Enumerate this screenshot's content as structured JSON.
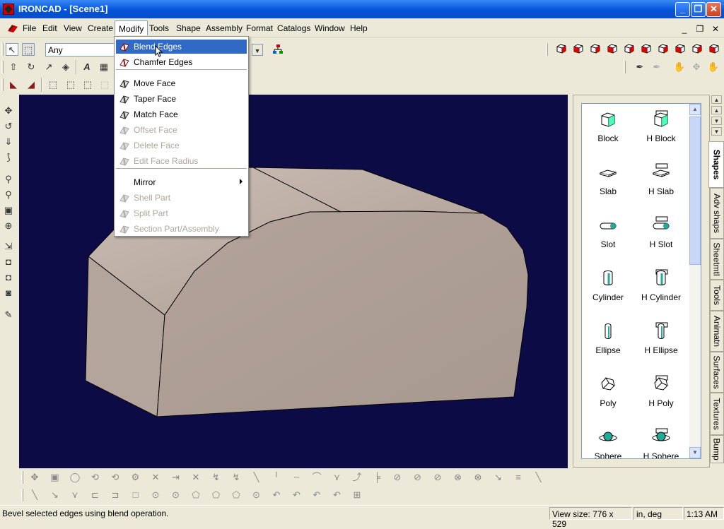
{
  "window": {
    "title": "IRONCAD - [Scene1]"
  },
  "menubar": {
    "items": [
      "File",
      "Edit",
      "View",
      "Create",
      "Modify",
      "Tools",
      "Shape",
      "Assembly",
      "Format",
      "Catalogs",
      "Window",
      "Help"
    ],
    "active": "Modify"
  },
  "toolbar": {
    "filter_value": "Any"
  },
  "modify_menu": {
    "items": [
      {
        "label": "Blend Edges",
        "state": "highlighted"
      },
      {
        "label": "Chamfer Edges",
        "state": "enabled"
      },
      {
        "label": "Move Face",
        "state": "enabled"
      },
      {
        "label": "Taper Face",
        "state": "enabled"
      },
      {
        "label": "Match Face",
        "state": "enabled"
      },
      {
        "label": "Offset Face",
        "state": "disabled"
      },
      {
        "label": "Delete Face",
        "state": "disabled"
      },
      {
        "label": "Edit Face Radius",
        "state": "disabled"
      },
      {
        "label": "Mirror",
        "state": "enabled",
        "submenu": true
      },
      {
        "label": "Shell Part",
        "state": "disabled"
      },
      {
        "label": "Split Part",
        "state": "disabled"
      },
      {
        "label": "Section Part/Assembly",
        "state": "disabled"
      }
    ]
  },
  "catalog": {
    "items": [
      {
        "label": "Block",
        "icon": "block-icon"
      },
      {
        "label": "H Block",
        "icon": "h-block-icon"
      },
      {
        "label": "Slab",
        "icon": "slab-icon"
      },
      {
        "label": "H Slab",
        "icon": "h-slab-icon"
      },
      {
        "label": "Slot",
        "icon": "slot-icon"
      },
      {
        "label": "H Slot",
        "icon": "h-slot-icon"
      },
      {
        "label": "Cylinder",
        "icon": "cylinder-icon"
      },
      {
        "label": "H Cylinder",
        "icon": "h-cylinder-icon"
      },
      {
        "label": "Ellipse",
        "icon": "ellipse-icon"
      },
      {
        "label": "H Ellipse",
        "icon": "h-ellipse-icon"
      },
      {
        "label": "Poly",
        "icon": "poly-icon"
      },
      {
        "label": "H Poly",
        "icon": "h-poly-icon"
      },
      {
        "label": "Sphere",
        "icon": "sphere-icon"
      },
      {
        "label": "H Sphere",
        "icon": "h-sphere-icon"
      }
    ]
  },
  "side_tabs": [
    "Shapes",
    "Adv shaps",
    "Sheetmtl",
    "Tools",
    "Animatn",
    "Surfaces",
    "Textures",
    "Bump"
  ],
  "status": {
    "message": "Bevel selected edges using blend operation.",
    "view_size": "View size:  776 x  529",
    "units": "in, deg",
    "time": "1:13 AM"
  },
  "colors": {
    "viewport_bg": "#0d0b45",
    "part_fill": "#b5a69c",
    "menu_highlight": "#316ac5"
  }
}
